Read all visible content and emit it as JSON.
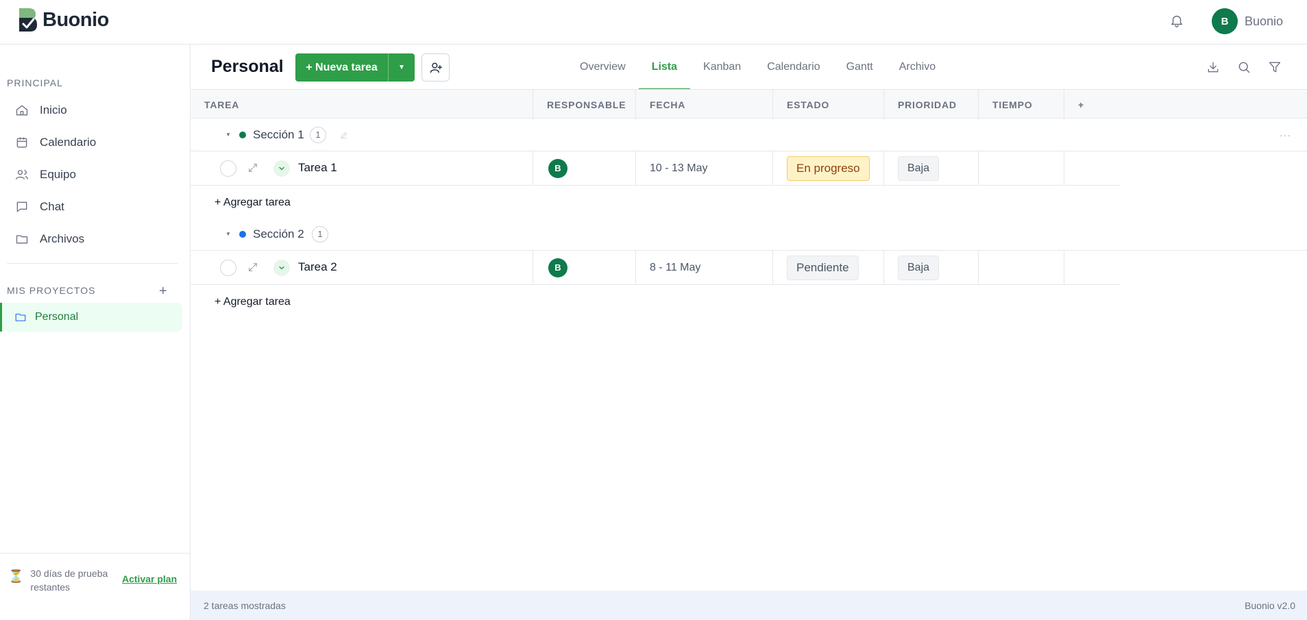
{
  "app": {
    "name": "Buonio"
  },
  "user": {
    "initial": "B",
    "name": "Buonio"
  },
  "sidebar": {
    "section_main": "PRINCIPAL",
    "items": [
      {
        "label": "Inicio",
        "icon": "home-icon"
      },
      {
        "label": "Calendario",
        "icon": "calendar-icon"
      },
      {
        "label": "Equipo",
        "icon": "users-icon"
      },
      {
        "label": "Chat",
        "icon": "chat-icon"
      },
      {
        "label": "Archivos",
        "icon": "folder-icon"
      }
    ],
    "section_projects": "MIS PROYECTOS",
    "add_project": "+",
    "projects": [
      {
        "label": "Personal",
        "icon": "folder-icon",
        "active": true
      }
    ],
    "trial_text": "30 días de prueba restantes",
    "trial_icon": "hourglass-icon",
    "activate_label": "Activar plan"
  },
  "header": {
    "title": "Personal",
    "new_task_label": "+ Nueva tarea",
    "tabs": [
      "Overview",
      "Lista",
      "Kanban",
      "Calendario",
      "Gantt",
      "Archivo"
    ],
    "active_tab": "Lista",
    "tools": [
      "download-icon",
      "search-icon",
      "filter-icon"
    ]
  },
  "table": {
    "columns": [
      "TAREA",
      "RESPONSABLE",
      "FECHA",
      "ESTADO",
      "PRIORIDAD",
      "TIEMPO",
      "+"
    ],
    "sections": [
      {
        "name": "Sección 1",
        "count": "1",
        "color": "#0f7a4c",
        "tasks": [
          {
            "name": "Tarea 1",
            "assignee": "B",
            "date": "10 - 13 May",
            "status": "En progreso",
            "priority": "Baja",
            "time": ""
          }
        ],
        "add_label": "+ Agregar tarea"
      },
      {
        "name": "Sección 2",
        "count": "1",
        "color": "#1a73e8",
        "tasks": [
          {
            "name": "Tarea 2",
            "assignee": "B",
            "date": "8 - 11 May",
            "status": "Pendiente",
            "priority": "Baja",
            "time": ""
          }
        ],
        "add_label": "+ Agregar tarea"
      }
    ]
  },
  "footer": {
    "count_text": "2 tareas mostradas",
    "version": "Buonio v2.0"
  },
  "colors": {
    "accent": "#2e9e48",
    "avatar": "#0f7a4c",
    "progress_bg": "#fef3c7"
  }
}
